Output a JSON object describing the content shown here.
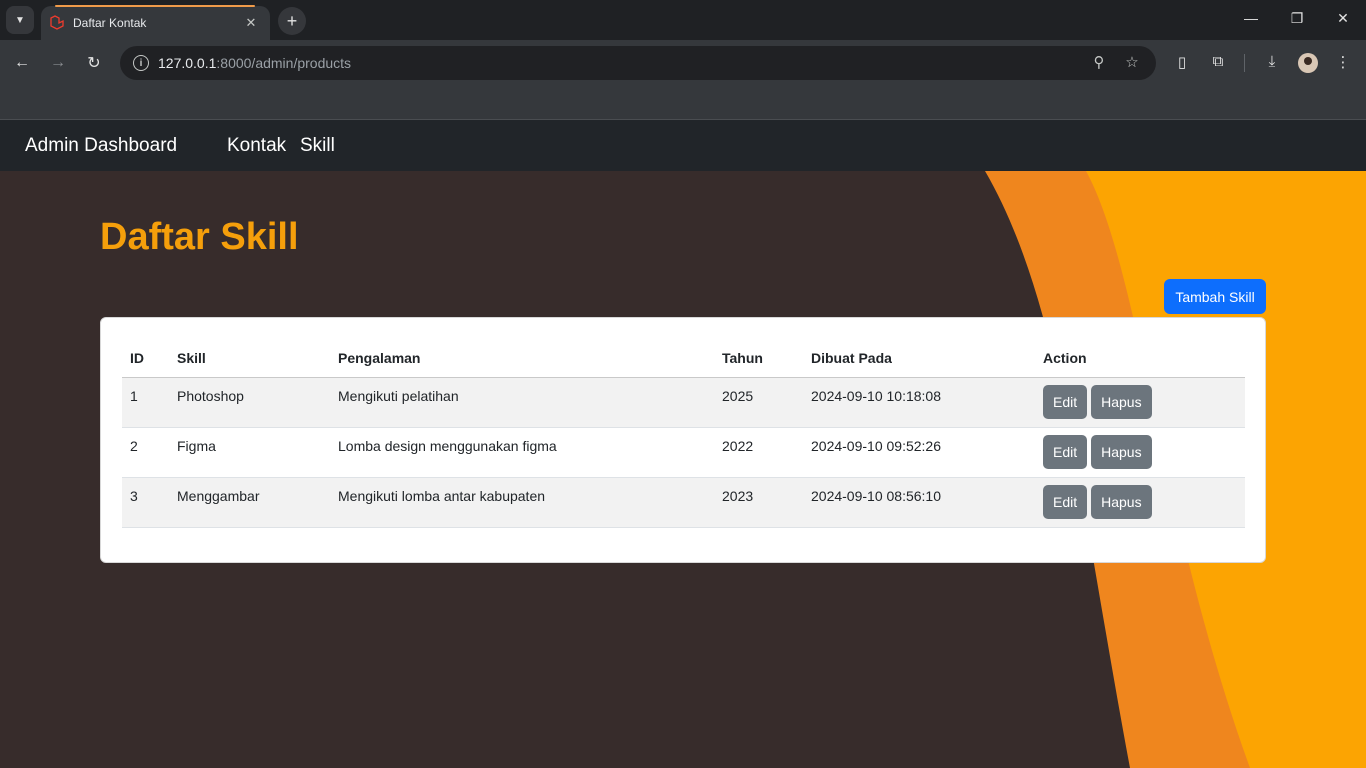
{
  "browser": {
    "tab_title": "Daftar Kontak",
    "url_host": "127.0.0.1",
    "url_rest": ":8000/admin/products"
  },
  "navbar": {
    "brand": "Admin Dashboard",
    "links": [
      "Kontak",
      "Skill"
    ]
  },
  "page": {
    "title": "Daftar Skill",
    "add_button": "Tambah Skill"
  },
  "table": {
    "headers": [
      "ID",
      "Skill",
      "Pengalaman",
      "Tahun",
      "Dibuat Pada",
      "Action"
    ],
    "rows": [
      {
        "id": "1",
        "skill": "Photoshop",
        "pengalaman": "Mengikuti pelatihan",
        "tahun": "2025",
        "dibuat": "2024-09-10 10:18:08"
      },
      {
        "id": "2",
        "skill": "Figma",
        "pengalaman": "Lomba design menggunakan figma",
        "tahun": "2022",
        "dibuat": "2024-09-10 09:52:26"
      },
      {
        "id": "3",
        "skill": "Menggambar",
        "pengalaman": "Mengikuti lomba antar kabupaten",
        "tahun": "2023",
        "dibuat": "2024-09-10 08:56:10"
      }
    ],
    "edit_label": "Edit",
    "delete_label": "Hapus"
  },
  "colors": {
    "accent": "#f59f0b",
    "primary_button": "#0d6efd",
    "secondary_button": "#6c757d",
    "page_bg": "#372c2b",
    "wave_dark_orange": "#ef861e",
    "wave_orange": "#fca402"
  }
}
